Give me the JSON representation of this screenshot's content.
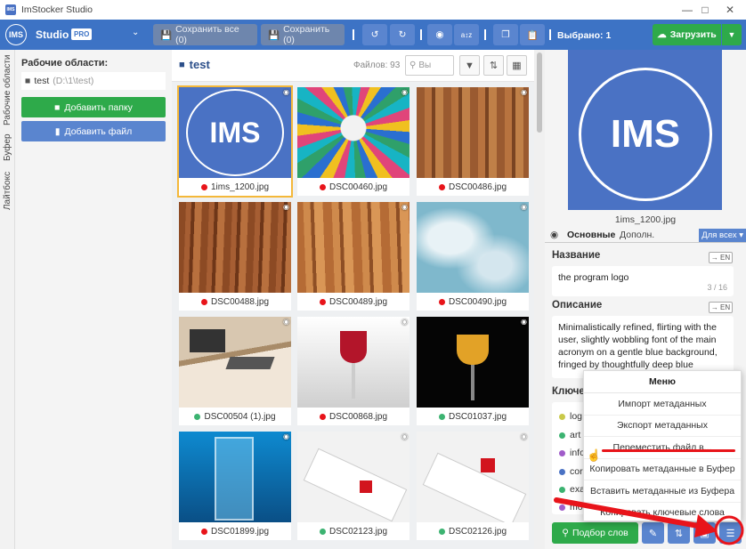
{
  "app": {
    "logo_text": "IMS",
    "title": "ImStocker Studio",
    "window_controls": [
      "minimize-icon",
      "maximize-icon",
      "close-icon"
    ]
  },
  "toolbar": {
    "avatar_text": "IMS",
    "product": "Studio",
    "badge": "PRO",
    "save_all_label": "Сохранить все (0)",
    "save_label": "Сохранить (0)",
    "icons": [
      "undo-icon",
      "redo-icon",
      "binoculars-icon",
      "sort-az-icon",
      "copy-icon",
      "paste-icon"
    ],
    "selected_label": "Выбрано: 1",
    "upload_label": "Загрузить"
  },
  "vertical_tabs": [
    "Рабочие области",
    "Буфер",
    "Лайтбокс"
  ],
  "sidebar": {
    "workspaces_label": "Рабочие области:",
    "workspace_name": "test",
    "workspace_path": "(D:\\1\\test)",
    "add_folder_label": "Добавить папку",
    "add_file_label": "Добавить файл"
  },
  "gallery": {
    "folder_title": "test",
    "files_count": "Файлов: 93",
    "search_placeholder": "Вы",
    "thumbnails": [
      {
        "name": "1ims_1200.jpg",
        "status": "red",
        "thumb_text": "IMS"
      },
      {
        "name": "DSC00460.jpg",
        "status": "red"
      },
      {
        "name": "DSC00486.jpg",
        "status": "red"
      },
      {
        "name": "DSC00488.jpg",
        "status": "red"
      },
      {
        "name": "DSC00489.jpg",
        "status": "red"
      },
      {
        "name": "DSC00490.jpg",
        "status": "red"
      },
      {
        "name": "DSC00504 (1).jpg",
        "status": "green"
      },
      {
        "name": "DSC00868.jpg",
        "status": "red"
      },
      {
        "name": "DSC01037.jpg",
        "status": "green"
      },
      {
        "name": "DSC01899.jpg",
        "status": "red"
      },
      {
        "name": "DSC02123.jpg",
        "status": "green"
      },
      {
        "name": "DSC02126.jpg",
        "status": "green"
      }
    ]
  },
  "preview": {
    "logo_text": "IMS",
    "filename": "1ims_1200.jpg"
  },
  "meta_tabs": {
    "main": "Основные",
    "extra": "Дополн.",
    "all_label": "Для всех"
  },
  "meta": {
    "title_label": "Название",
    "title_lang": "→ EN",
    "title_value": "the program logo",
    "title_counter": "3 / 16",
    "desc_label": "Описание",
    "desc_lang": "→ EN",
    "desc_value": "Minimalistically refined, flirting with the user, slightly wobbling font of the main acronym on a gentle blue background, fringed by thoughtfully deep blue",
    "keywords_label": "Ключе",
    "keywords": [
      {
        "text": "log",
        "color": "#c9c94a"
      },
      {
        "text": "art",
        "color": "#3cb371"
      },
      {
        "text": "info",
        "color": "#a05cc9"
      },
      {
        "text": "cor",
        "color": "#4a72c4"
      },
      {
        "text": "exa",
        "color": "#3cb371"
      },
      {
        "text": "mo",
        "color": "#a05cc9"
      }
    ]
  },
  "bottom": {
    "pick_words_label": "Подбор слов"
  },
  "menu": {
    "title": "Меню",
    "items": [
      "Импорт метаданных",
      "Экспорт метаданных",
      "Переместить файл в...",
      "Копировать метаданные в Буфер",
      "Вставить метаданные из Буфера",
      "Копировать ключевые слова"
    ]
  },
  "colors": {
    "toolbar": "#3d73c5",
    "accent_blue": "#5a85cf",
    "green": "#2eaa4a",
    "red_annotation": "#e8141a",
    "status_red": "#e8141a",
    "status_green": "#3cb371"
  }
}
